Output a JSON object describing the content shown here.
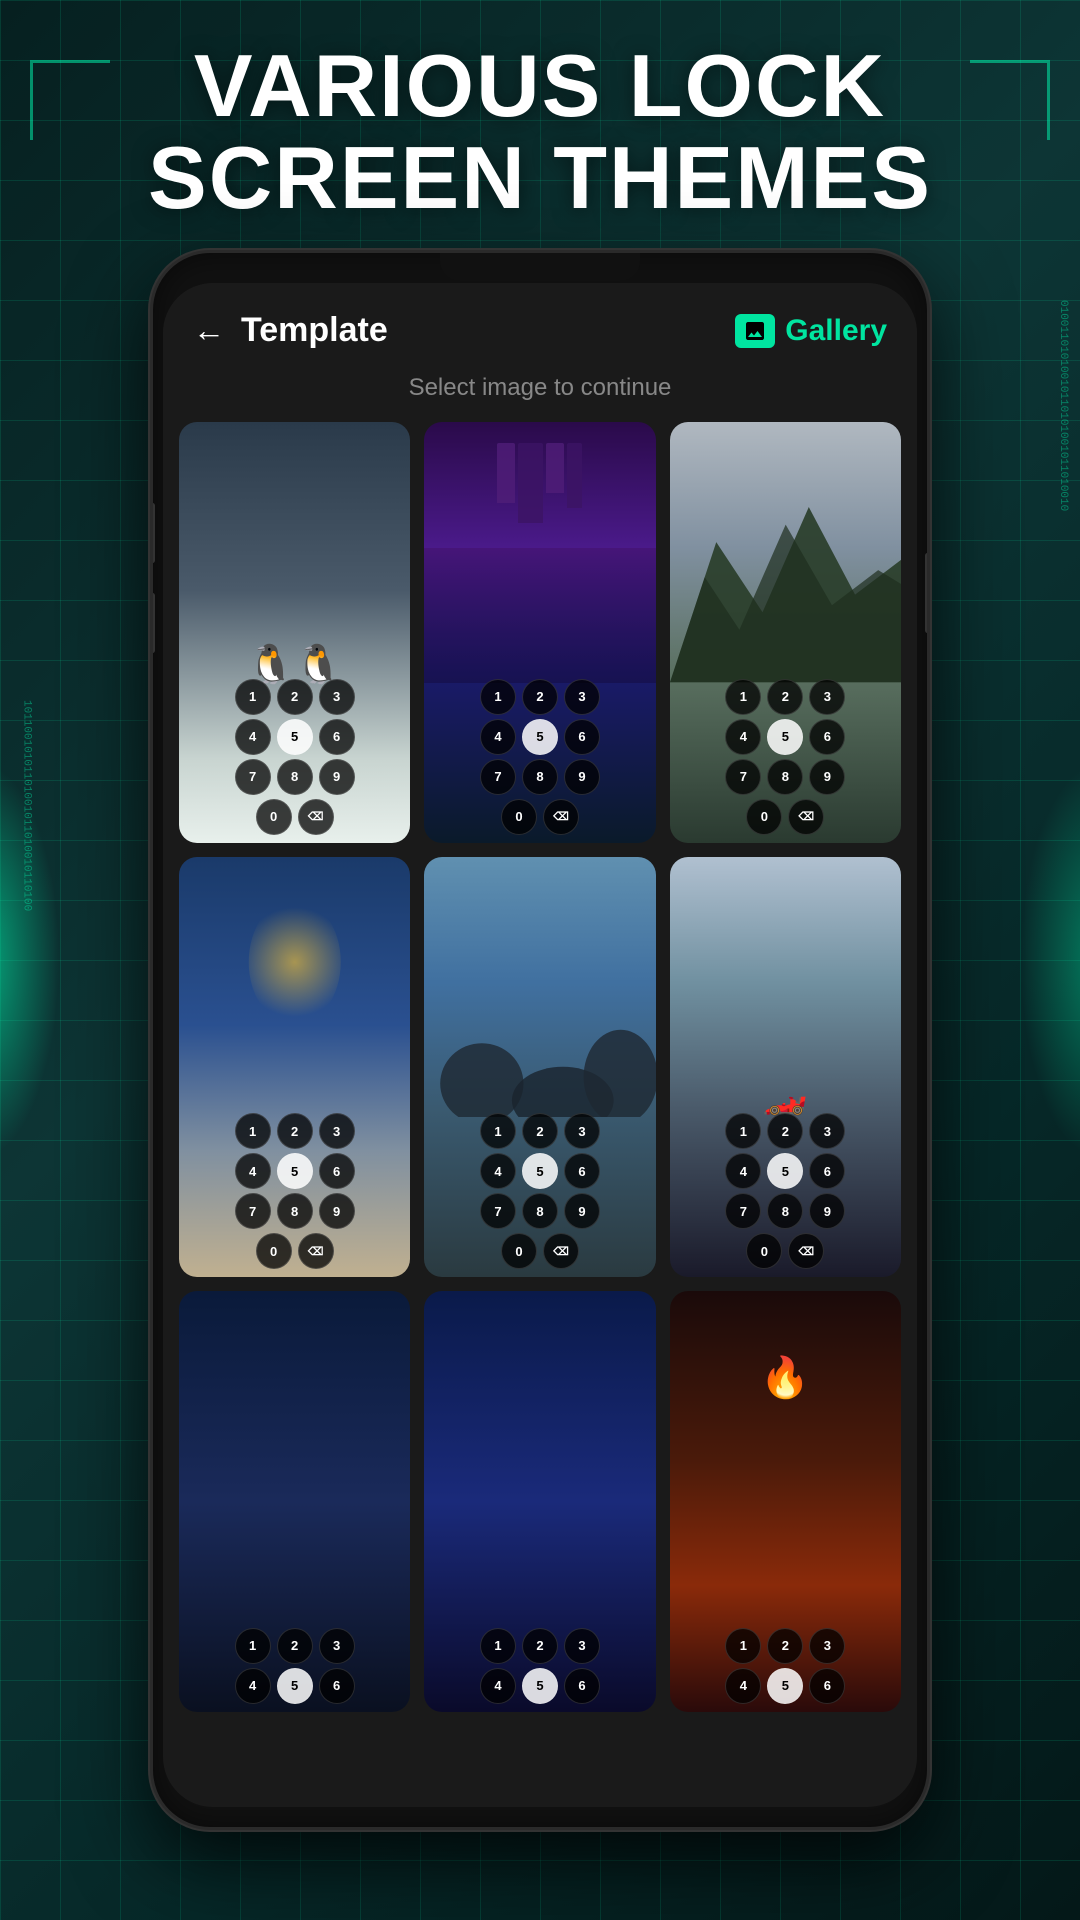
{
  "background": {
    "color": "#0a2a2a"
  },
  "header": {
    "line1": "VARIOUS LOCK",
    "line2": "SCREEN THEMES"
  },
  "app": {
    "title": "Template",
    "subtitle": "Select image to continue",
    "back_label": "←",
    "gallery_label": "Gallery"
  },
  "keypad": {
    "rows": [
      [
        "1",
        "2",
        "3"
      ],
      [
        "4",
        "5",
        "6"
      ],
      [
        "7",
        "8",
        "9"
      ],
      [
        "0",
        "⌫"
      ]
    ],
    "active_key": "5"
  },
  "themes": [
    {
      "id": "penguins",
      "style": "card-penguins"
    },
    {
      "id": "city-night",
      "style": "card-city"
    },
    {
      "id": "mountains",
      "style": "card-mountains"
    },
    {
      "id": "beach",
      "style": "card-beach"
    },
    {
      "id": "river",
      "style": "card-river"
    },
    {
      "id": "sports-car",
      "style": "card-car"
    },
    {
      "id": "dark-blue",
      "style": "card-dark-blue"
    },
    {
      "id": "space-blue",
      "style": "card-space"
    },
    {
      "id": "fire-abstract",
      "style": "card-fire"
    }
  ]
}
